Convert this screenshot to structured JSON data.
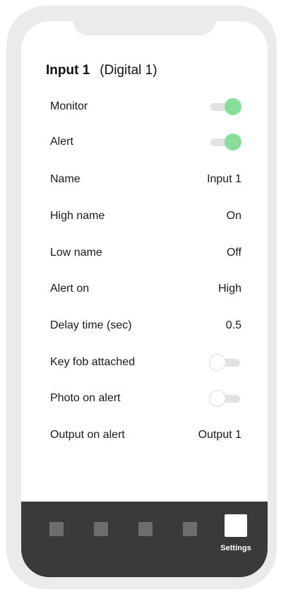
{
  "header": {
    "title": "Input 1",
    "subtitle": "(Digital 1)"
  },
  "settings": {
    "monitor": {
      "label": "Monitor",
      "enabled": true
    },
    "alert": {
      "label": "Alert",
      "enabled": true
    },
    "name": {
      "label": "Name",
      "value": "Input 1"
    },
    "high_name": {
      "label": "High name",
      "value": "On"
    },
    "low_name": {
      "label": "Low name",
      "value": "Off"
    },
    "alert_on": {
      "label": "Alert on",
      "value": "High"
    },
    "delay_time": {
      "label": "Delay time (sec)",
      "value": "0.5"
    },
    "key_fob": {
      "label": "Key fob attached",
      "enabled": false
    },
    "photo_on_alert": {
      "label": "Photo on alert",
      "enabled": false
    },
    "output_on_alert": {
      "label": "Output on alert",
      "value": "Output 1"
    }
  },
  "tabbar": {
    "active_tab_label": "Settings",
    "tabs": [
      "tab-1-icon",
      "tab-2-icon",
      "tab-3-icon",
      "tab-4-icon",
      "settings-icon"
    ]
  },
  "colors": {
    "toggle_on": "#88dd9b",
    "toggle_track": "#e2e2e2",
    "tabbar_bg": "#3a3a3a",
    "tab_inactive": "#6d6d6d",
    "tab_active": "#ffffff"
  }
}
